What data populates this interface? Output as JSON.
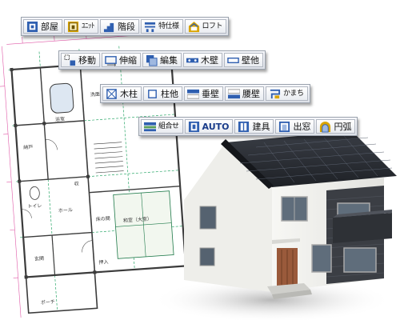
{
  "toolbars": {
    "row1": {
      "room": "部屋",
      "unit": "ﾕﾆｯﾄ",
      "stairs": "階段",
      "special_spec": "特仕様",
      "loft": "ロフト"
    },
    "row2": {
      "move": "移動",
      "stretch": "伸縮",
      "edit": "編集",
      "wood_wall": "木壁",
      "wall_other": "壁他"
    },
    "row3": {
      "wood_column": "木柱",
      "column_other": "柱他",
      "hanging_wall": "垂壁",
      "waist_wall": "腰壁",
      "kamachi": "かまち"
    },
    "row4": {
      "combine": "組合せ",
      "auto": "AUTO",
      "fixtures": "建具",
      "bay_window": "出窓",
      "arc": "円弧"
    }
  },
  "floor_plan": {
    "labels": {
      "bath": "浴室",
      "washroom": "洗面・脱衣",
      "storage": "納戸",
      "toilet": "トイレ",
      "hall": "ホール",
      "closet": "収",
      "entrance": "玄関",
      "porch": "ポーチ",
      "tokonoma": "床の間",
      "oshiire": "押入",
      "washitsu": "和室（大室）"
    }
  },
  "colors": {
    "toolbar_border": "#9aa2ad",
    "icon_blue": "#2f5fb0",
    "plan_wall": "#3b3b3b",
    "plan_dim": "#e05aa8",
    "plan_grid": "#2ca86a",
    "roof": "#2a2d33",
    "house_wall": "#f3f3f0"
  }
}
